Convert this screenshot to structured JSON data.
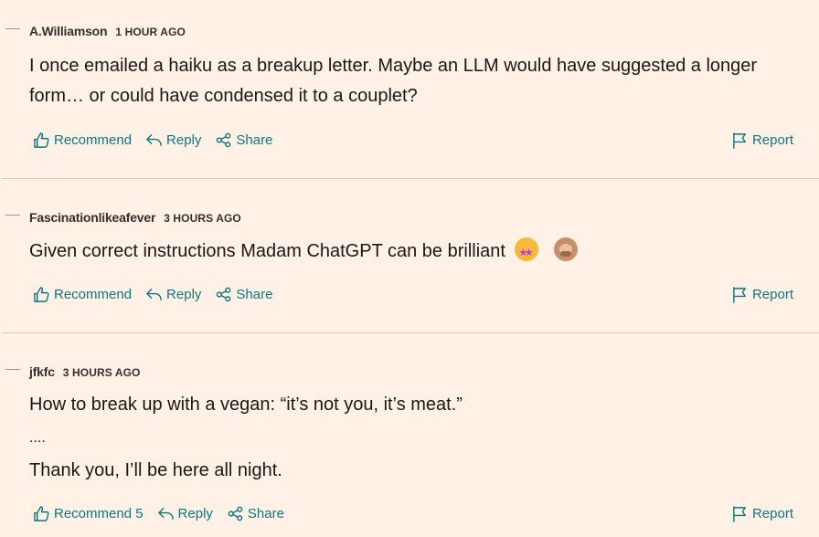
{
  "comments": [
    {
      "author": "A.Williamson",
      "time": "1 HOUR AGO",
      "lines": [
        "I once emailed a haiku as a breakup letter. Maybe an LLM would have suggested a longer",
        "form… or could have condensed it to a couplet?"
      ],
      "recommend": "Recommend",
      "reply": "Reply",
      "share": "Share",
      "report": "Report"
    },
    {
      "author": "Fascinationlikeafever",
      "time": "3 HOURS AGO",
      "lines": [
        "Given correct instructions Madam ChatGPT can be brilliant"
      ],
      "emojis": [
        "star-struck-emoji",
        "speak-no-evil-monkey-emoji"
      ],
      "recommend": "Recommend",
      "reply": "Reply",
      "share": "Share",
      "report": "Report"
    },
    {
      "author": "jfkfc",
      "time": "3 HOURS AGO",
      "lines": [
        "How to break up with a vegan: “it’s not you, it’s meat.”",
        "....",
        "Thank you, I’ll be here all night."
      ],
      "recommend": "Recommend 5",
      "reply": "Reply",
      "share": "Share",
      "report": "Report"
    }
  ],
  "colors": {
    "background": "#fff1e5",
    "action": "#0d7680",
    "divider": "#cfcbc6"
  }
}
